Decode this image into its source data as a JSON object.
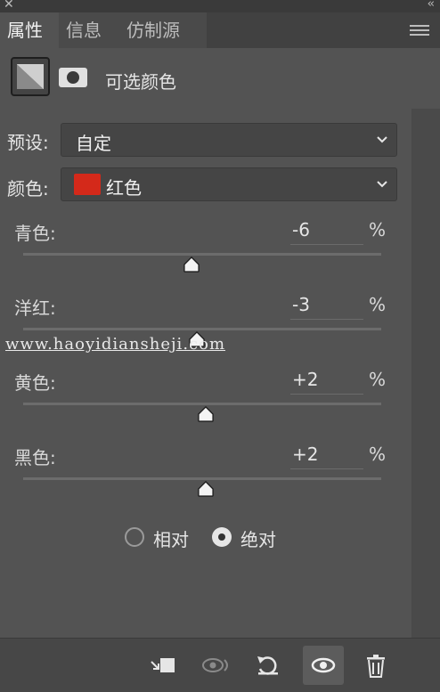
{
  "tabs": [
    {
      "label": "属性"
    },
    {
      "label": "信息"
    },
    {
      "label": "仿制源"
    }
  ],
  "header": {
    "title": "可选颜色"
  },
  "preset": {
    "label": "预设:",
    "value": "自定"
  },
  "color": {
    "label": "颜色:",
    "value": "红色",
    "swatch": "#d4291a"
  },
  "sliders": [
    {
      "label": "青色:",
      "value": "-6",
      "unit": "%",
      "position": -6
    },
    {
      "label": "洋红:",
      "value": "-3",
      "unit": "%",
      "position": -3
    },
    {
      "label": "黄色:",
      "value": "+2",
      "unit": "%",
      "position": 2
    },
    {
      "label": "黑色:",
      "value": "+2",
      "unit": "%",
      "position": 2
    }
  ],
  "method": {
    "relative": "相对",
    "absolute": "绝对",
    "selected": "absolute"
  },
  "watermark": "www.haoyidiansheji.com",
  "icons": {
    "close": "close-icon",
    "collapse": "double-chevron-icon",
    "menu": "hamburger-menu-icon",
    "adjustment": "adjustment-layer-icon",
    "mask": "layer-mask-icon",
    "clip": "clip-to-layer-icon",
    "view_previous": "view-previous-state-icon",
    "reset": "reset-icon",
    "visibility": "eye-icon",
    "delete": "trash-icon"
  }
}
